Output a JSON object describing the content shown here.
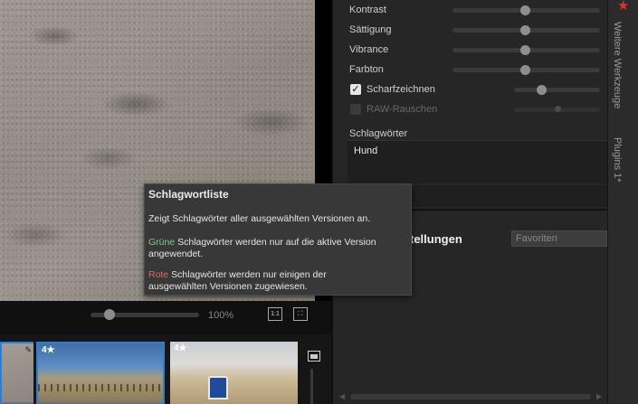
{
  "viewer": {
    "zoom": {
      "value_text": "100%",
      "one_to_one_label": "1:1",
      "fit_label": "⛶"
    }
  },
  "filmstrip": {
    "thumbnails": [
      {
        "rating": "",
        "has_edit_icon": true
      },
      {
        "rating": "4★"
      },
      {
        "rating": "4★"
      }
    ]
  },
  "inspector": {
    "adjustments": [
      {
        "label": "Kontrast",
        "level": 0.5
      },
      {
        "label": "Sättigung",
        "level": 0.5
      },
      {
        "label": "Vibrance",
        "level": 0.5
      },
      {
        "label": "Farbton",
        "level": 0.5
      }
    ],
    "sharpen": {
      "label": "Scharfzeichnen",
      "checked": true,
      "level": 0.3
    },
    "raw_noise": {
      "label": "RAW-Rauschen",
      "checked": false,
      "enabled": false,
      "level": 0.5
    },
    "keywords": {
      "title": "Schlagwörter",
      "value": "Hund"
    },
    "presets": {
      "title": "tellungen",
      "selected": "Favoriten"
    }
  },
  "tabs": {
    "tools": "Weitere Werkzeuge",
    "plugins": "Plugins 1*"
  },
  "tooltip": {
    "title": "Schlagwortliste",
    "line1": "Zeigt Schlagwörter aller ausgewählten Versionen an.",
    "green_word": "Grüne",
    "green_rest1": " Schlagwörter werden nur auf die aktive Version",
    "green_rest2": "angewendet.",
    "red_word": "Rote",
    "red_rest1": " Schlagwörter werden nur einigen der",
    "red_rest2": "ausgewählten Versionen zugewiesen."
  },
  "colors": {
    "accent_selection": "#2d7fd6",
    "favorite_star": "#d8322b",
    "tooltip_green": "#7fc97a",
    "tooltip_red": "#e06666"
  }
}
